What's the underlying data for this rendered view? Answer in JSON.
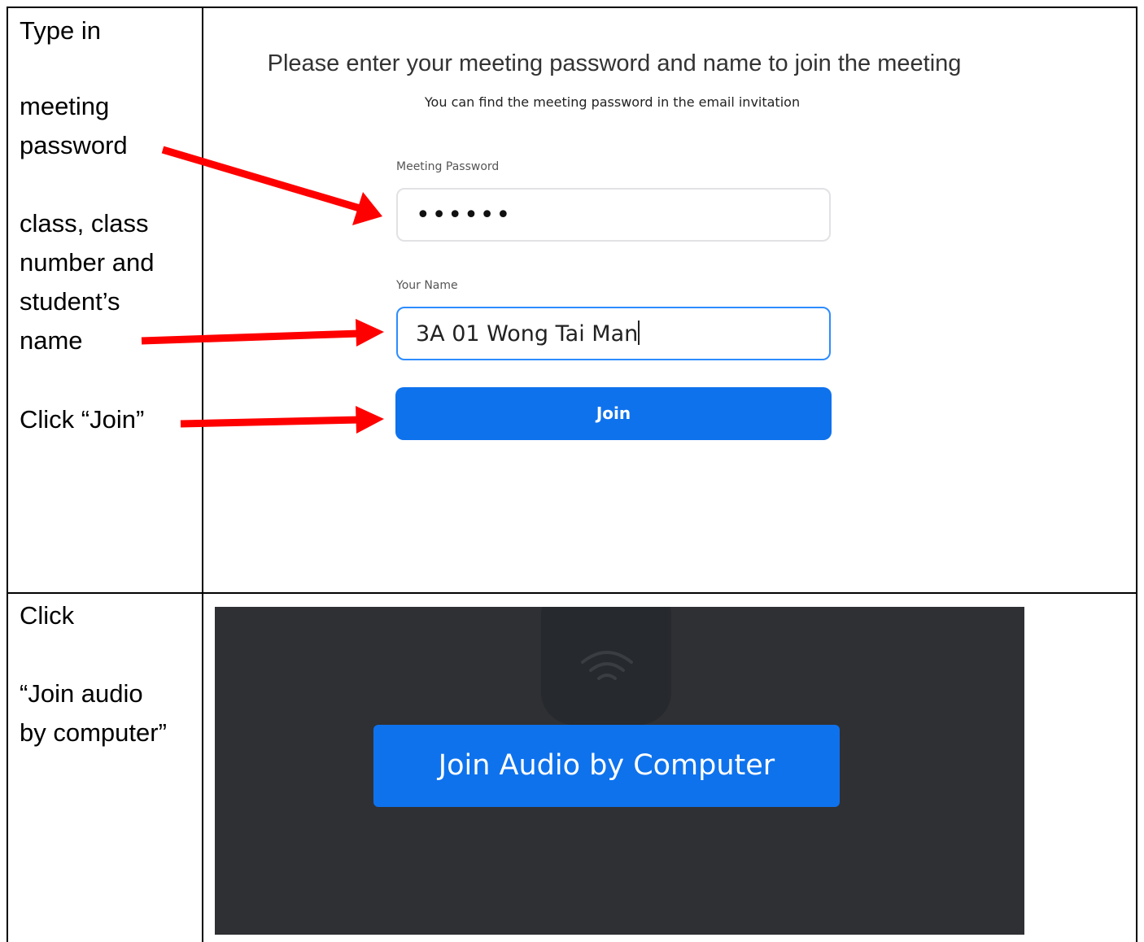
{
  "instructions": {
    "row1": [
      "Type in",
      "meeting",
      "password",
      "class, class",
      "number and",
      "student’s",
      "name",
      "Click “Join”"
    ],
    "row2": [
      "Click",
      "“Join audio",
      "by computer”"
    ]
  },
  "join_form": {
    "title": "Please enter your meeting password and name to join the meeting",
    "subtitle": "You can find the meeting password in the email invitation",
    "password_label": "Meeting Password",
    "password_value": "••••••",
    "name_label": "Your Name",
    "name_value": "3A 01 Wong Tai Man",
    "join_button": "Join"
  },
  "audio": {
    "button_label": "Join Audio by Computer",
    "icon": "headphone-icon"
  },
  "colors": {
    "arrow": "#ff0000",
    "button_blue": "#0e72ed",
    "focus_border": "#2d8cff",
    "audio_bg": "#2f3033"
  }
}
